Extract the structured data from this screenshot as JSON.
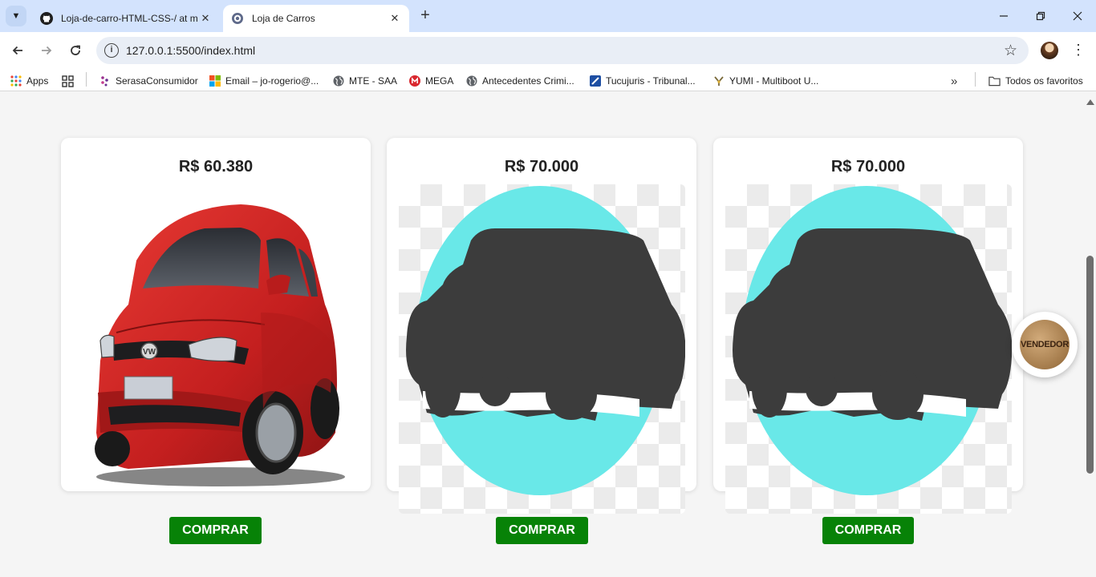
{
  "browser": {
    "tabs": [
      {
        "title": "Loja-de-carro-HTML-CSS-/ at m",
        "active": false,
        "icon": "github-icon"
      },
      {
        "title": "Loja de Carros",
        "active": true,
        "icon": "site-globe-icon"
      }
    ],
    "url": "127.0.0.1:5500/index.html",
    "bookmarks": [
      {
        "label": "Apps",
        "icon": "apps-grid-icon"
      },
      {
        "label": "SerasaConsumidor",
        "icon": "serasa-icon"
      },
      {
        "label": "Email – jo-rogerio@...",
        "icon": "microsoft-icon"
      },
      {
        "label": "MTE - SAA",
        "icon": "globe-icon"
      },
      {
        "label": "MEGA",
        "icon": "mega-icon"
      },
      {
        "label": "Antecedentes Crimi...",
        "icon": "globe-icon"
      },
      {
        "label": "Tucujuris - Tribunal...",
        "icon": "tucujuris-icon"
      },
      {
        "label": "YUMI - Multiboot U...",
        "icon": "yumi-icon"
      }
    ],
    "all_bookmarks_label": "Todos os favoritos"
  },
  "products": [
    {
      "price": "R$ 60.380",
      "image": "red-hatchback-car",
      "buy_label": "COMPRAR"
    },
    {
      "price": "R$ 70.000",
      "image": "car-silhouette-placeholder",
      "buy_label": "COMPRAR"
    },
    {
      "price": "R$ 70.000",
      "image": "car-silhouette-placeholder",
      "buy_label": "COMPRAR"
    }
  ],
  "seller_badge": "VENDEDOR",
  "colors": {
    "buy_button": "#078207",
    "silhouette_circle": "#69e8e8",
    "silhouette": "#3c3c3c",
    "car_body": "#d62b2b"
  }
}
